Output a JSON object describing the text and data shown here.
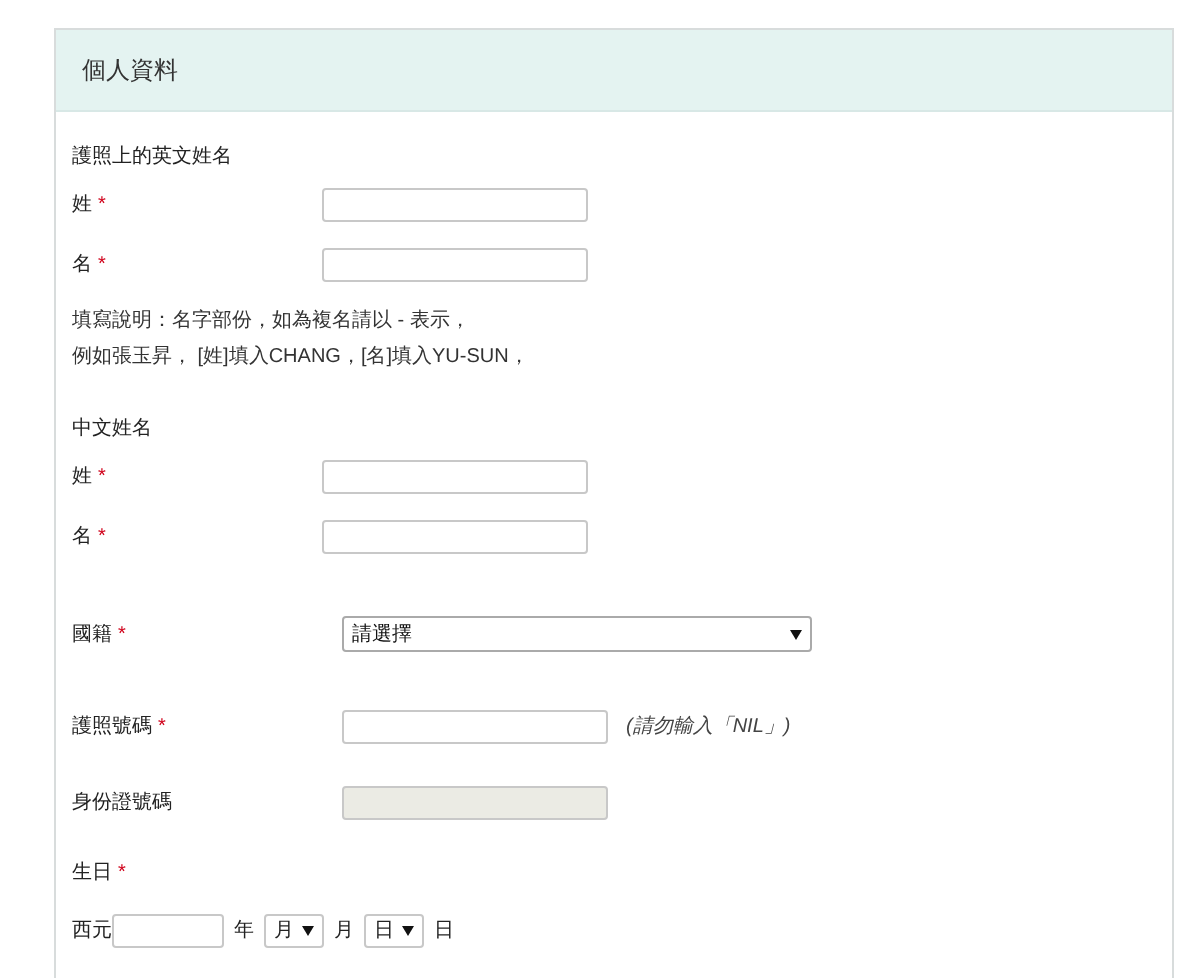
{
  "panel": {
    "title": "個人資料"
  },
  "sections": [
    {
      "kind": "name",
      "heading": "護照上的英文姓名",
      "fields": [
        {
          "kind": "text",
          "label": "姓",
          "mark": "*"
        },
        {
          "kind": "text",
          "label": "名",
          "mark": "*"
        },
        {
          "kind": "note",
          "lines": [
            "填寫說明：名字部份，如為複名請以 - 表示，",
            "例如張玉昇， [姓]填入CHANG，[名]填入YU-SUN，"
          ]
        }
      ]
    },
    {
      "kind": "name",
      "heading": "中文姓名",
      "fields": [
        {
          "kind": "text",
          "label": "姓",
          "mark": "*"
        },
        {
          "kind": "text",
          "label": "名",
          "mark": "*"
        }
      ]
    },
    {
      "kind": "detail",
      "fields": [
        {
          "kind": "select",
          "label": "國籍",
          "mark": "*",
          "value": "請選擇"
        },
        {
          "kind": "text",
          "label": "護照號碼",
          "mark": "*",
          "hint": "(請勿輸入「NIL」)"
        },
        {
          "kind": "text",
          "label": "身份證號碼",
          "disabled": true
        },
        {
          "kind": "label",
          "label": "生日",
          "mark": "*"
        },
        {
          "kind": "date",
          "prefix": "西元",
          "year_unit": "年",
          "month": "月",
          "month_unit": "月",
          "day": "日",
          "day_unit": "日"
        }
      ]
    }
  ]
}
